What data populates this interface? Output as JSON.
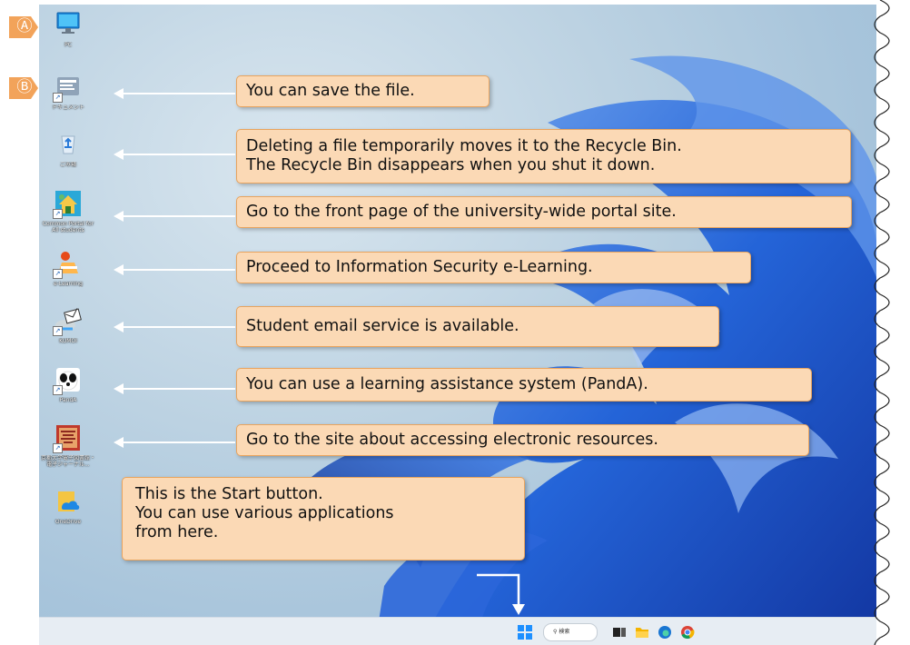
{
  "desktop": {
    "icons": [
      {
        "label": "PC"
      },
      {
        "label": "ドキュメント"
      },
      {
        "label": "ごみ箱"
      },
      {
        "label": "Common Portal for All students"
      },
      {
        "label": "e-Learning"
      },
      {
        "label": "KUMOI"
      },
      {
        "label": "PandA"
      },
      {
        "label": "京都大学電子図書館・電子ジャーナル..."
      },
      {
        "label": "OneDrive"
      }
    ],
    "badges": {
      "a": "Ⓐ",
      "b": "Ⓑ"
    }
  },
  "callouts": {
    "save": "You can save the file.",
    "recycle_line1": "Deleting a file temporarily moves it to the Recycle Bin.",
    "recycle_line2": "The Recycle Bin disappears when you shut it down.",
    "portal": "Go to the front page of the university-wide portal site.",
    "elearning": "Proceed to Information Security e-Learning.",
    "email": "Student email service is available.",
    "panda": "You can use a learning assistance system (PandA).",
    "eresources": "Go to the site about accessing electronic resources.",
    "start_line1": "This is the Start button.",
    "start_line2": "You can use various applications",
    "start_line3": "from here."
  },
  "taskbar": {
    "search_label": "検索",
    "apps": [
      "start-icon",
      "search-icon",
      "task-view-icon",
      "file-explorer-icon",
      "edge-icon",
      "chrome-icon"
    ]
  },
  "colors": {
    "callout_fill": "#fbd9b5",
    "callout_border": "#e8a45f",
    "badge": "#f2a35a",
    "swirl": "#1d5fd8"
  }
}
